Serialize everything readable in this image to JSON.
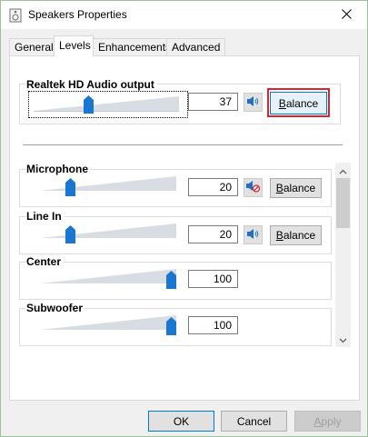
{
  "window": {
    "title": "Speakers Properties",
    "close_icon": "close-icon",
    "app_icon": "speaker-device-icon"
  },
  "tabs": [
    {
      "label": "General",
      "active": false
    },
    {
      "label": "Levels",
      "active": true
    },
    {
      "label": "Enhancements",
      "active": false
    },
    {
      "label": "Advanced",
      "active": false
    }
  ],
  "main_output": {
    "label": "Realtek HD Audio output",
    "value": "37",
    "level_fraction": 0.37,
    "mute_icon": "speaker-icon",
    "balance_label_prefix": "",
    "balance_label_ul": "B",
    "balance_label_rest": "alance"
  },
  "inputs": [
    {
      "label": "Microphone",
      "value": "20",
      "level_fraction": 0.2,
      "muted": true,
      "mute_icon": "speaker-muted-icon",
      "balance_ul": "B",
      "balance_rest": "alance"
    },
    {
      "label": "Line In",
      "value": "20",
      "level_fraction": 0.2,
      "muted": false,
      "mute_icon": "speaker-icon",
      "balance_ul": "B",
      "balance_rest": "alance"
    },
    {
      "label": "Center",
      "value": "100",
      "level_fraction": 1.0
    },
    {
      "label": "Subwoofer",
      "value": "100",
      "level_fraction": 1.0
    }
  ],
  "buttons": {
    "ok": "OK",
    "cancel": "Cancel",
    "apply_ul": "A",
    "apply_rest": "pply"
  },
  "colors": {
    "accent": "#0078d7",
    "thumb": "#1976d2",
    "focus_outline": "#d9232e"
  }
}
